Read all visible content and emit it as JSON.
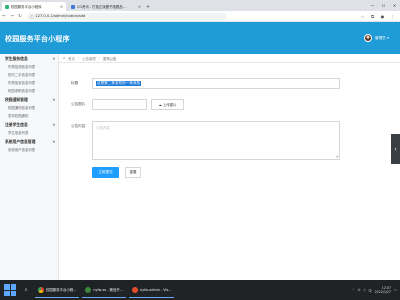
{
  "browser": {
    "tabs": [
      {
        "title": "校园服务平台小程序",
        "active": true
      },
      {
        "title": "CG资讯 - 打造正版图书馆藏品...",
        "active": false
      }
    ],
    "new_tab": "+",
    "url": "127.0.0.1/admin/notice/add",
    "window_controls": {
      "minimize": "—",
      "maximize": "☐",
      "close": "✕"
    }
  },
  "header": {
    "app_title": "校园服务平台小程序",
    "username": "管理员",
    "accent_color": "#1f9bd8"
  },
  "sidebar": {
    "groups": [
      {
        "title": "学生服务信息",
        "items": [
          "失物招领信息列表",
          "校内二手信息列表",
          "失物信息信息列表",
          "校园求职信息列表"
        ]
      },
      {
        "title": "校园通知管理",
        "items": [
          "校园通知信息列表",
          "发布校园通知"
        ]
      },
      {
        "title": "注册学生信息",
        "items": [
          "学生信息列表"
        ]
      },
      {
        "title": "系统用户信息管理",
        "items": [
          "系统用户信息列表"
        ]
      }
    ]
  },
  "breadcrumb": {
    "items": [
      "首页",
      "公告管理",
      "发布公告"
    ]
  },
  "form": {
    "title_label": "标题",
    "title_value": "这是第二条发布的一条消息",
    "image_label": "公告图片",
    "upload_label": "上传图片",
    "content_label": "公告内容",
    "content_placeholder": "公告内容",
    "submit_label": "立即提交",
    "reset_label": "重置"
  },
  "taskbar": {
    "apps": [
      {
        "label": "校园服务平台小程...",
        "icon": "chrome-icon"
      },
      {
        "label": "nyfw-ss - 微信开...",
        "icon": "node-icon"
      },
      {
        "label": "nyfw-admin - Vis...",
        "icon": "dev-icon"
      }
    ],
    "clock_time": "12:07",
    "clock_date": "2022/1/27",
    "lang": "中"
  }
}
